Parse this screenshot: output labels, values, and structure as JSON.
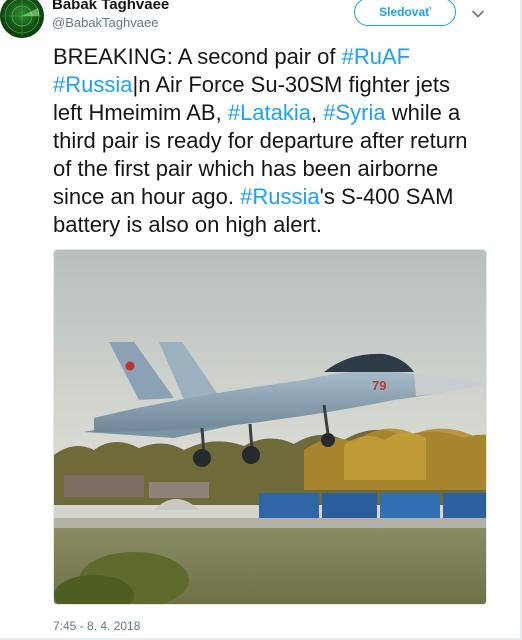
{
  "tweet": {
    "author": {
      "name": "Babak Taghvaee",
      "handle": "@BabakTaghvaee"
    },
    "follow_label": "Sledovať",
    "text_parts": [
      "BREAKING: A second pair of ",
      "#RuAF",
      " ",
      "#Russia",
      "|n Air Force Su-30SM fighter jets left Hmeimim AB, ",
      "#Latakia",
      ", ",
      "#Syria",
      " while a third pair is ready for departure after return of the first pair which has been airborne since an hour ago. ",
      "#Russia",
      "'s S-400 SAM battery is also on high alert."
    ],
    "aircraft_marking": "79",
    "timestamp": "7:45 - 8. 4. 2018"
  },
  "icons": {
    "avatar": "radar-avatar-icon",
    "menu": "chevron-down-icon"
  },
  "colors": {
    "accent": "#1da1f2",
    "text": "#14171a",
    "muted": "#657786"
  }
}
